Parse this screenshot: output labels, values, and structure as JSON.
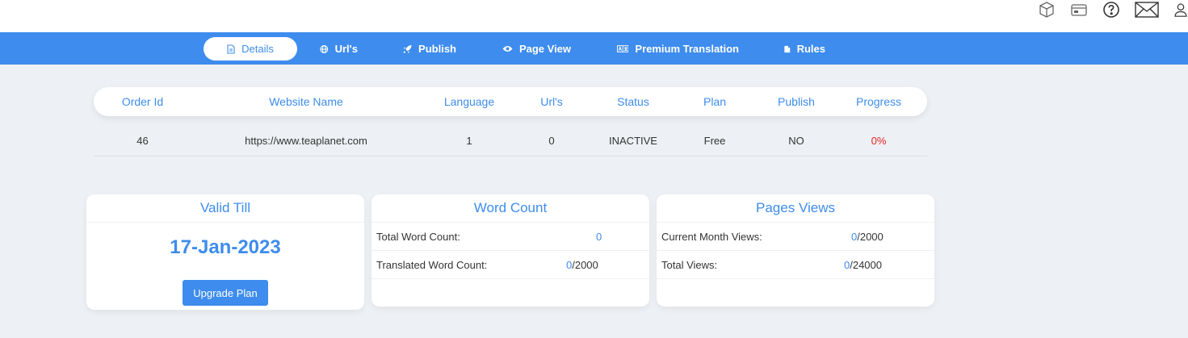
{
  "nav": {
    "tabs": [
      {
        "label": "Details",
        "icon": "file-icon",
        "active": true
      },
      {
        "label": "Url's",
        "icon": "globe-icon"
      },
      {
        "label": "Publish",
        "icon": "rocket-icon"
      },
      {
        "label": "Page View",
        "icon": "eye-icon"
      },
      {
        "label": "Premium Translation",
        "icon": "translate-icon"
      },
      {
        "label": "Rules",
        "icon": "document-icon"
      }
    ]
  },
  "header_icons": [
    "box-icon",
    "credit-card-icon",
    "help-icon",
    "mail-icon",
    "user-icon"
  ],
  "orders": {
    "columns": [
      "Order Id",
      "Website Name",
      "Language",
      "Url's",
      "Status",
      "Plan",
      "Publish",
      "Progress"
    ],
    "rows": [
      [
        "46",
        "https://www.teaplanet.com",
        "1",
        "0",
        "INACTIVE",
        "Free",
        "NO",
        "0%"
      ]
    ]
  },
  "valid_till": {
    "title": "Valid Till",
    "date": "17-Jan-2023",
    "button": "Upgrade Plan"
  },
  "word_count": {
    "title": "Word Count",
    "total_label": "Total Word Count:",
    "total_value": "0",
    "translated_label": "Translated Word Count:",
    "translated_value": "0",
    "translated_limit": "/2000"
  },
  "page_views": {
    "title": "Pages Views",
    "month_label": "Current Month Views:",
    "month_value": "0",
    "month_limit": "/2000",
    "total_label": "Total Views:",
    "total_value": "0",
    "total_limit": "/24000"
  },
  "colors": {
    "accent": "#3e8ced",
    "background": "#edf0f4",
    "progress_zero": "#e52525"
  }
}
